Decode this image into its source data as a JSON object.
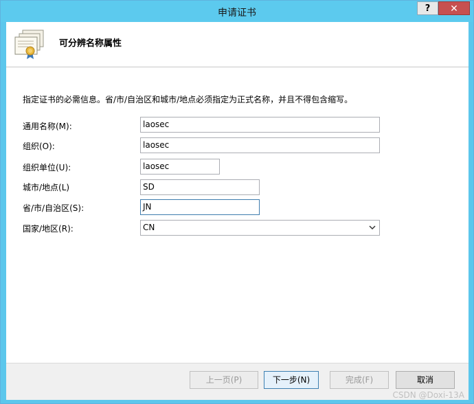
{
  "window": {
    "title": "申请证书",
    "help_glyph": "?",
    "close_glyph": "✕"
  },
  "header": {
    "title": "可分辨名称属性",
    "icon": "certificate-icon"
  },
  "instruction": "指定证书的必需信息。省/市/自治区和城市/地点必须指定为正式名称，并且不得包含缩写。",
  "fields": {
    "common_name": {
      "label": "通用名称(M):",
      "value": "laosec"
    },
    "organization": {
      "label": "组织(O):",
      "value": "laosec"
    },
    "org_unit": {
      "label": "组织单位(U):",
      "value": "laosec"
    },
    "city": {
      "label": "城市/地点(L)",
      "value": "SD"
    },
    "state": {
      "label": "省/市/自治区(S):",
      "value": "JN"
    },
    "country": {
      "label": "国家/地区(R):",
      "value": "CN"
    }
  },
  "buttons": {
    "prev": "上一页(P)",
    "next": "下一步(N)",
    "finish": "完成(F)",
    "cancel": "取消"
  },
  "watermark": "CSDN @Doxi-13A",
  "colors": {
    "titlebar": "#5ccaee",
    "close": "#c75050",
    "focus_border": "#3c7fb1"
  }
}
